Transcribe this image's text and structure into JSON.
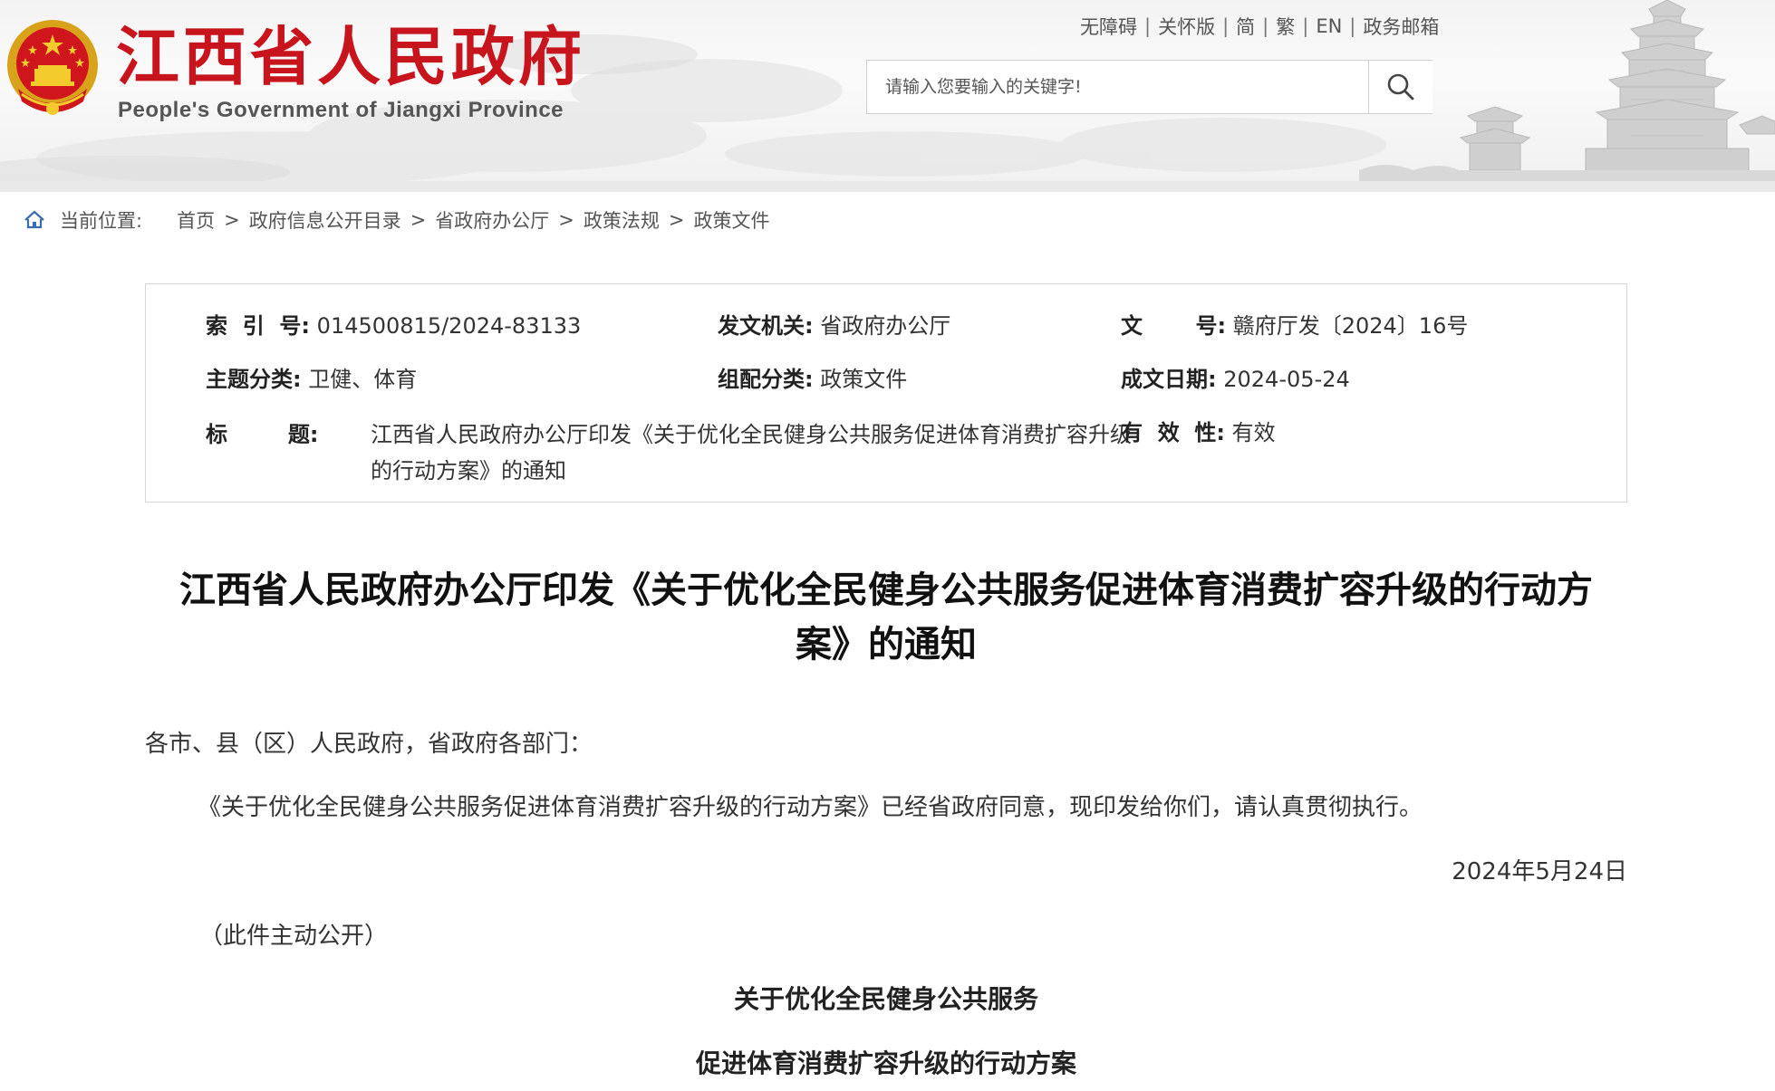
{
  "header": {
    "site_title": "江西省人民政府",
    "site_subtitle": "People's Government of Jiangxi Province",
    "top_links": [
      "无障碍",
      "关怀版",
      "简",
      "繁",
      "EN",
      "政务邮箱"
    ],
    "search": {
      "placeholder": "请输入您要输入的关键字!"
    },
    "colors": {
      "brand_red": "#c8141c"
    }
  },
  "breadcrumb": {
    "label": "当前位置:",
    "items": [
      "首页",
      "政府信息公开目录",
      "省政府办公厅",
      "政策法规",
      "政策文件"
    ],
    "separator": ">"
  },
  "info": {
    "index_label": "索  引  号:",
    "index_value": "014500815/2024-83133",
    "issuer_label": "发文机关:",
    "issuer_value": "省政府办公厅",
    "docno_label": "文       号:",
    "docno_value": "赣府厅发〔2024〕16号",
    "topic_label": "主题分类:",
    "topic_value": "卫健、体育",
    "category_label": "组配分类:",
    "category_value": "政策文件",
    "date_label": "成文日期:",
    "date_value": "2024-05-24",
    "title_label": "标        题:",
    "title_value": "江西省人民政府办公厅印发《关于优化全民健身公共服务促进体育消费扩容升级的行动方案》的通知",
    "validity_label": "有  效  性:",
    "validity_value": "有效"
  },
  "article": {
    "title": "江西省人民政府办公厅印发《关于优化全民健身公共服务促进体育消费扩容升级的行动方案》的通知",
    "salutation": "各市、县（区）人民政府，省政府各部门：",
    "body": "《关于优化全民健身公共服务促进体育消费扩容升级的行动方案》已经省政府同意，现印发给你们，请认真贯彻执行。",
    "date": "2024年5月24日",
    "note": "（此件主动公开）",
    "subhead_1": "关于优化全民健身公共服务",
    "subhead_2": "促进体育消费扩容升级的行动方案"
  }
}
